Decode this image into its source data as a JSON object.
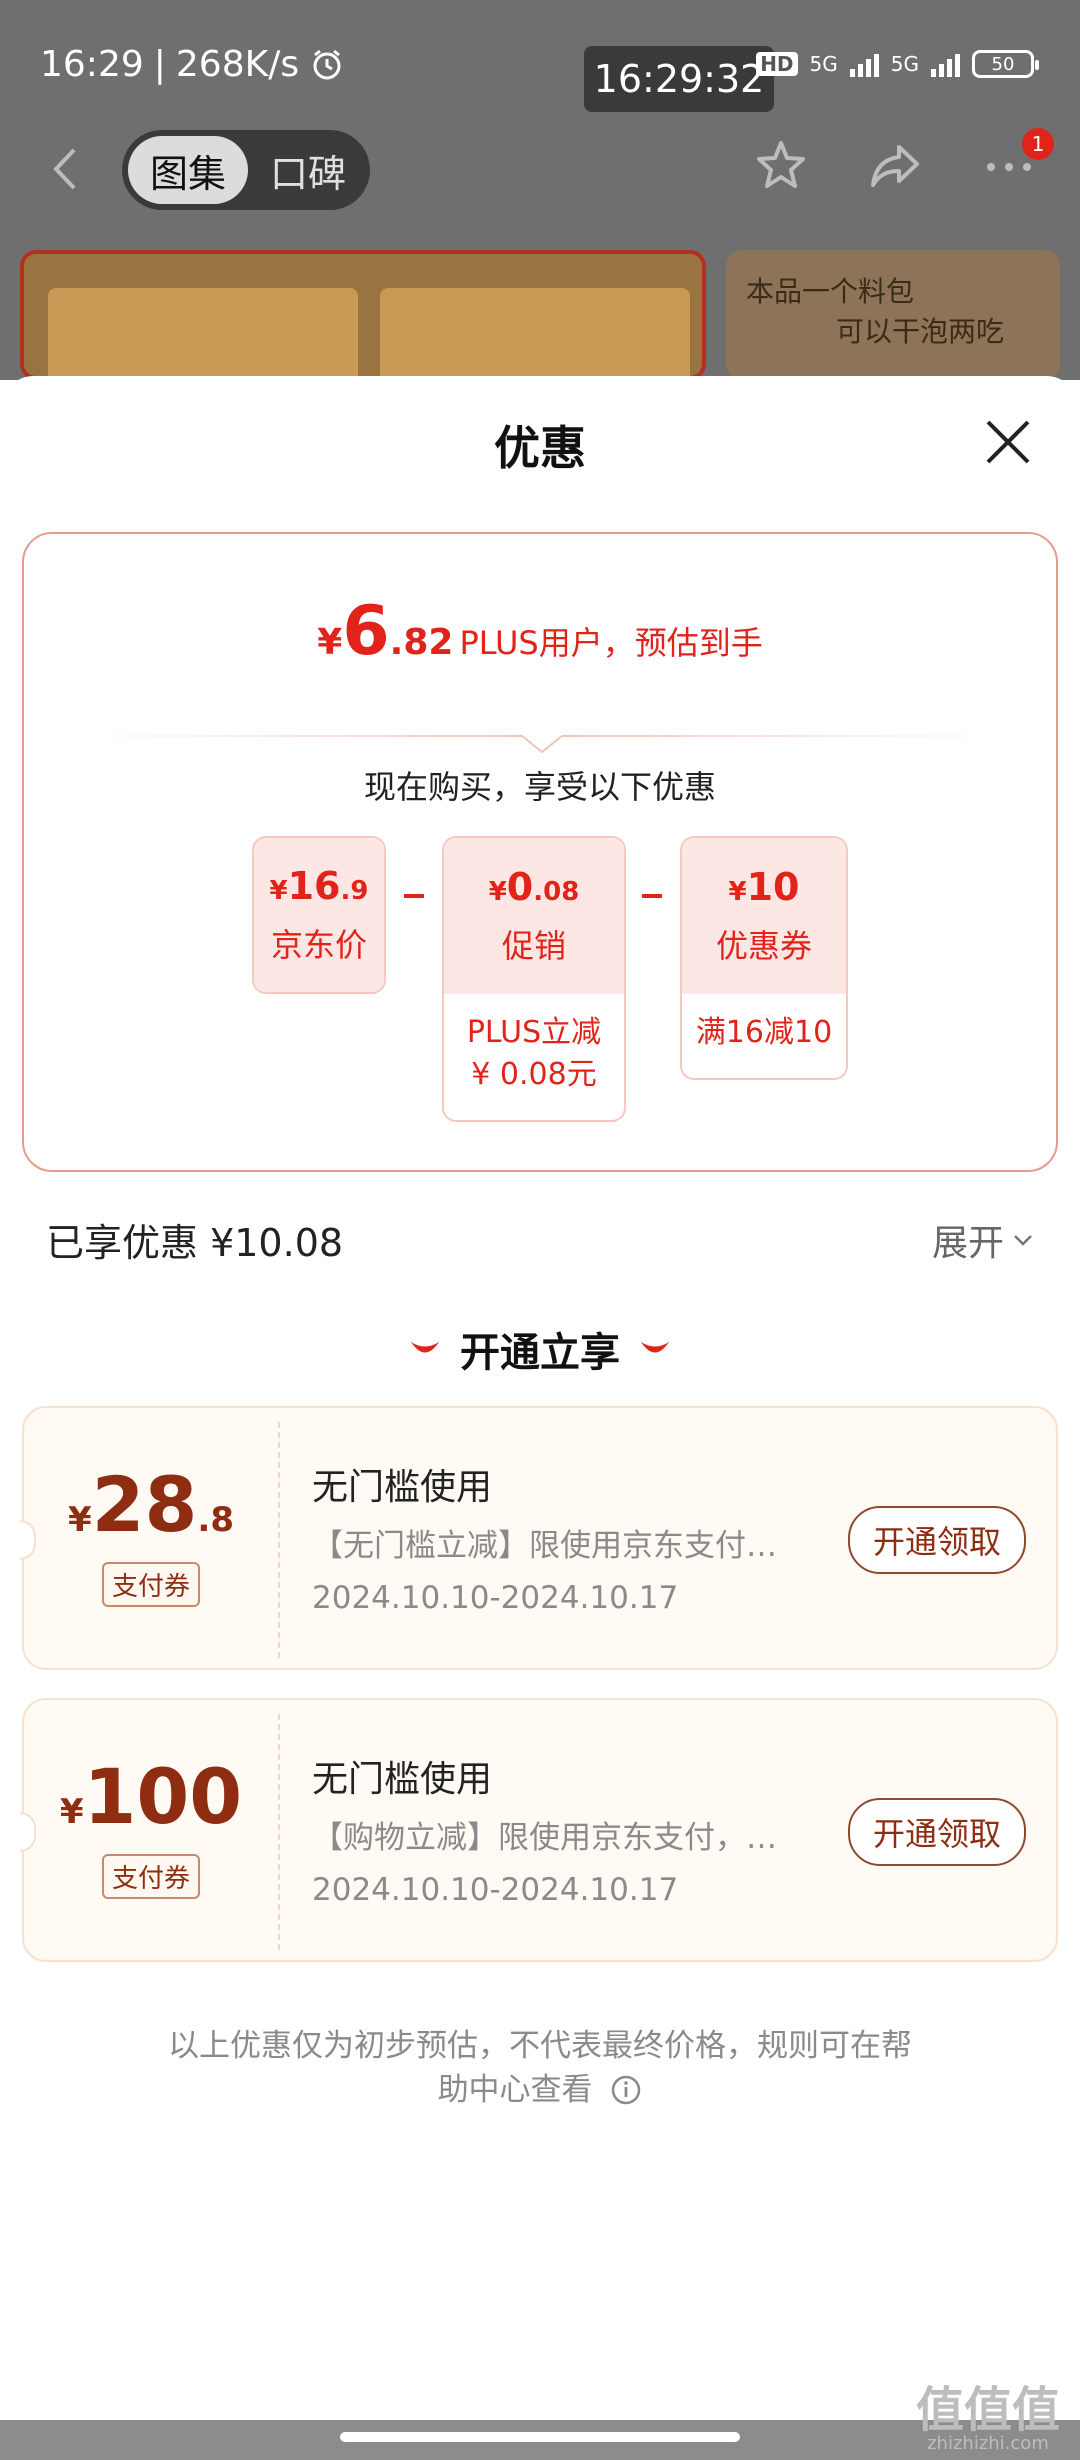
{
  "status_bar": {
    "time": "16:29",
    "speed": "268K/s",
    "clock_overlay": "16:29:32",
    "hd_label": "HD",
    "net1": "5G",
    "net2": "5G",
    "battery": "50"
  },
  "nav": {
    "tabs": [
      "图集",
      "口碑"
    ],
    "active_tab": 0,
    "badge_count": "1"
  },
  "backdrop": {
    "photo2_text_line1": "本品一个料包",
    "photo2_text_line2": "可以干泡两吃"
  },
  "sheet": {
    "title": "优惠",
    "estimate": {
      "currency": "¥",
      "integer": "6",
      "decimal": ".82",
      "note": "PLUS用户，预估到手"
    },
    "buy_text": "现在购买，享受以下优惠",
    "breakdown": [
      {
        "currency": "¥",
        "integer": "16",
        "decimal": ".9",
        "label": "京东价"
      },
      {
        "currency": "¥",
        "integer": "0",
        "decimal": ".08",
        "label": "促销",
        "detail_line1": "PLUS立减",
        "detail_line2": "¥ 0.08元"
      },
      {
        "currency": "¥",
        "integer": "10",
        "decimal": "",
        "label": "优惠券",
        "detail_line1": "满16减10"
      }
    ],
    "saved_text": "已享优惠 ¥10.08",
    "expand_label": "展开",
    "open_section_title": "开通立享",
    "coupons": [
      {
        "currency": "¥",
        "integer": "28",
        "decimal": ".8",
        "tag": "支付券",
        "name": "无门槛使用",
        "desc": "【无门槛立减】限使用京东支付…",
        "date": "2024.10.10-2024.10.17",
        "button": "开通领取"
      },
      {
        "currency": "¥",
        "integer": "100",
        "decimal": "",
        "tag": "支付券",
        "name": "无门槛使用",
        "desc": "【购物立减】限使用京东支付，…",
        "date": "2024.10.10-2024.10.17",
        "button": "开通领取"
      }
    ],
    "disclaimer_line1": "以上优惠仅为初步预估，不代表最终价格，规则可在帮",
    "disclaimer_line2": "助中心查看"
  },
  "watermark": {
    "main": "值值值",
    "sub": "zhizhizhi.com"
  },
  "colors": {
    "accent_red": "#e2231a",
    "coupon_brown": "#8f2d12"
  }
}
